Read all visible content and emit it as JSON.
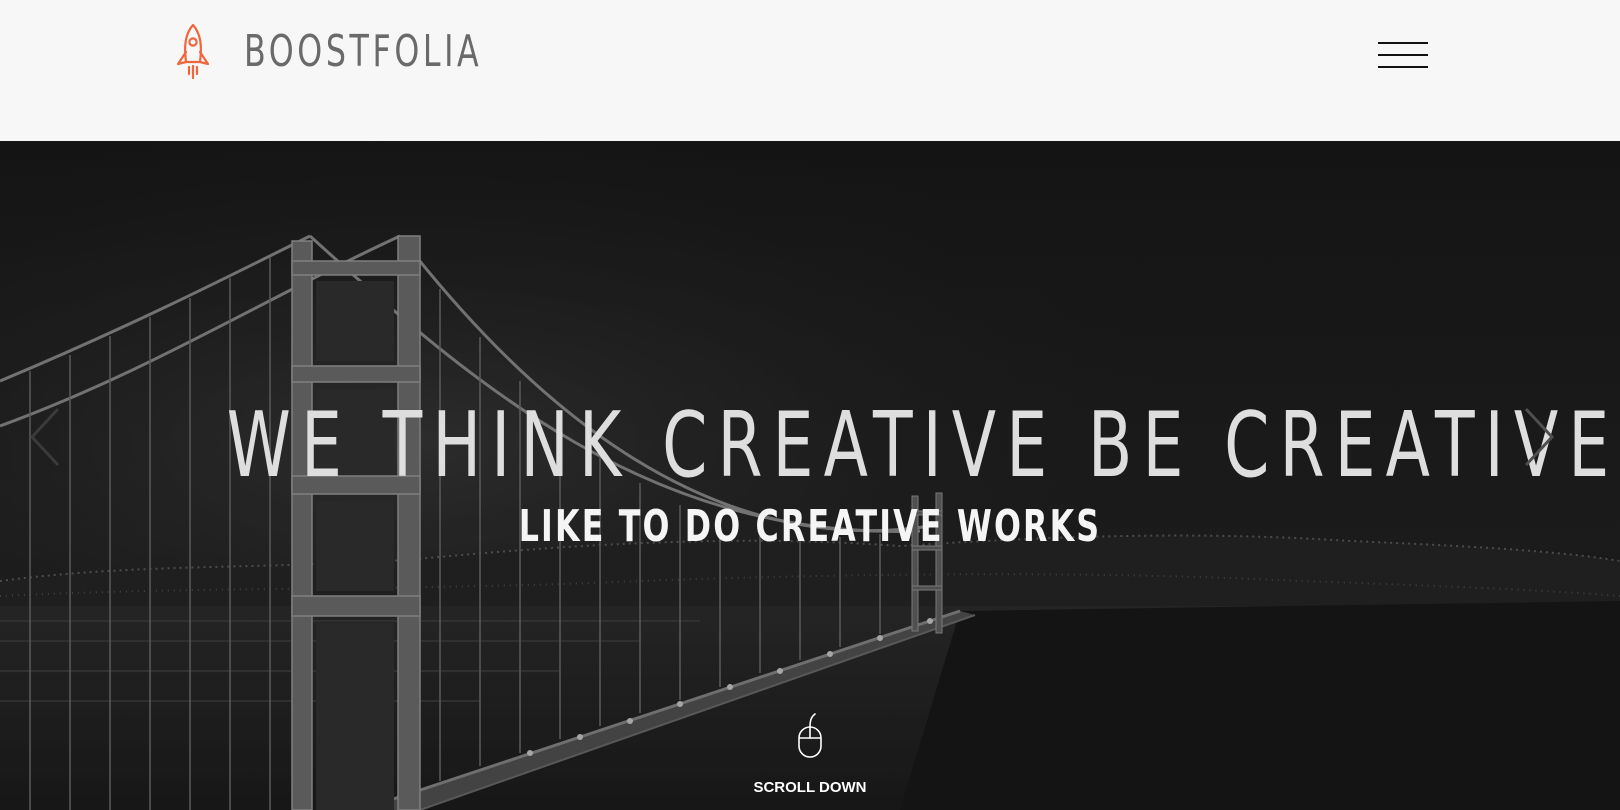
{
  "header": {
    "brand": "BOOSTFOLIA",
    "logo_icon": "rocket-icon",
    "menu_icon": "hamburger-menu-icon"
  },
  "hero": {
    "headline": "WE THINK CREATIVE BE CREATIVE",
    "subline": "LIKE TO DO CREATIVE WORKS",
    "next_icon": "chevron-right-icon",
    "prev_icon": "chevron-left-icon",
    "scroll_icon": "mouse-icon",
    "scroll_label": "SCROLL DOWN"
  },
  "colors": {
    "accent": "#f0663c",
    "brand_text": "#6a6a6a",
    "header_bg": "#f8f7f8",
    "hero_bg": "#1f1f1f",
    "headline": "#dedede"
  }
}
